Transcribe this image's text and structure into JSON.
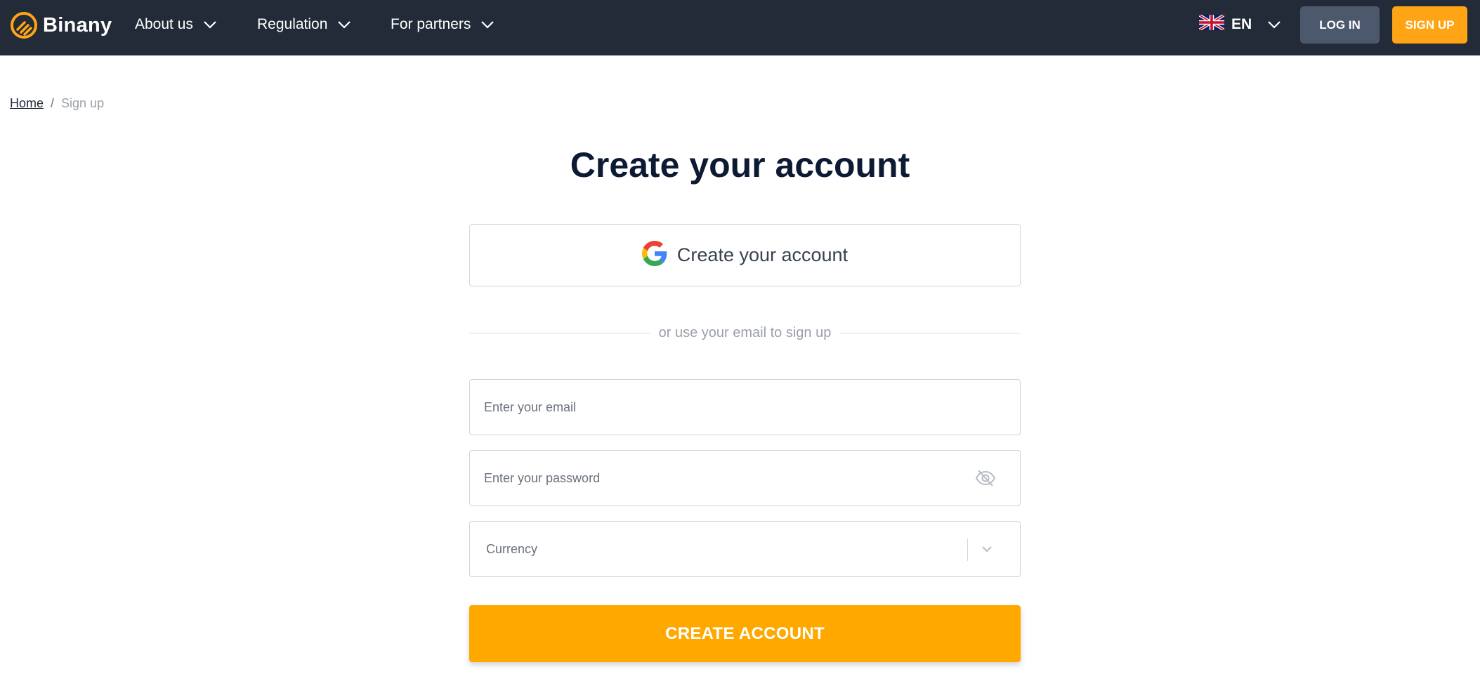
{
  "header": {
    "brand": "Binany",
    "nav": [
      {
        "label": "About us"
      },
      {
        "label": "Regulation"
      },
      {
        "label": "For partners"
      }
    ],
    "language": "EN",
    "login_label": "LOG IN",
    "signup_label": "SIGN UP"
  },
  "breadcrumb": {
    "home": "Home",
    "separator": "/",
    "current": "Sign up"
  },
  "main": {
    "title": "Create your account",
    "google_button_label": "Create your account",
    "divider_text": "or use your email to sign up",
    "email_placeholder": "Enter your email",
    "password_placeholder": "Enter your password",
    "currency_placeholder": "Currency",
    "submit_label": "CREATE ACCOUNT"
  },
  "colors": {
    "topbar": "#232b38",
    "accent": "#ffa800",
    "login_button": "#4c586b",
    "title": "#0c1a33"
  },
  "icons": [
    "binany-logo-icon",
    "chevron-down-icon",
    "uk-flag-icon",
    "google-icon",
    "eye-off-icon"
  ]
}
